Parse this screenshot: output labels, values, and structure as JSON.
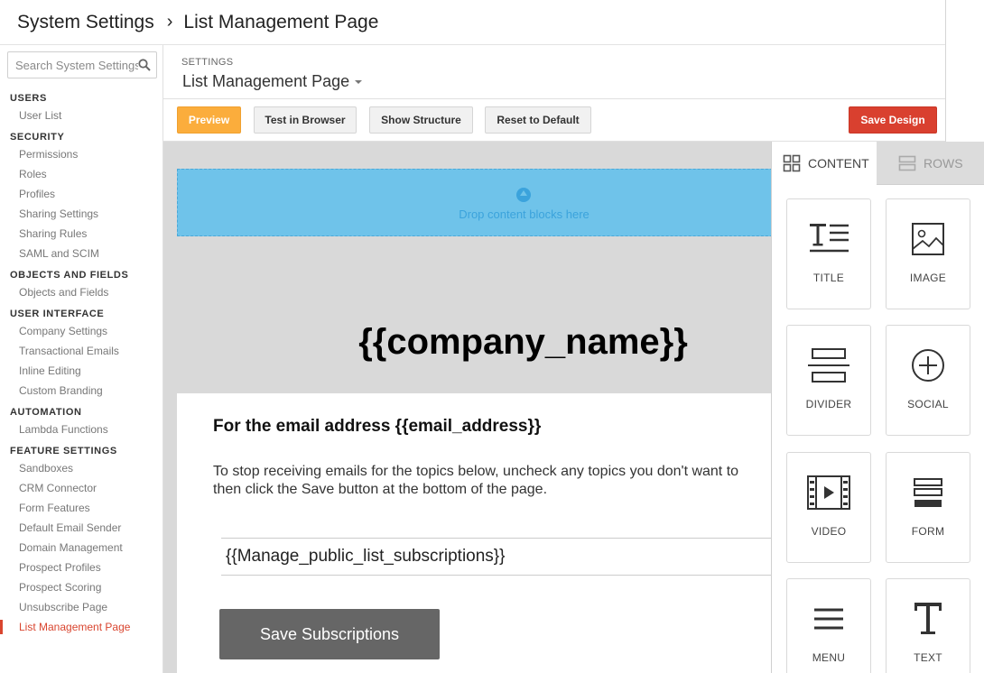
{
  "breadcrumb": {
    "root": "System Settings",
    "separator": "›",
    "current": "List Management Page"
  },
  "search": {
    "placeholder": "Search System Settings"
  },
  "sidebar": {
    "sections": [
      {
        "title": "USERS",
        "items": [
          "User List"
        ]
      },
      {
        "title": "SECURITY",
        "items": [
          "Permissions",
          "Roles",
          "Profiles",
          "Sharing Settings",
          "Sharing Rules",
          "SAML and SCIM"
        ]
      },
      {
        "title": "OBJECTS AND FIELDS",
        "items": [
          "Objects and Fields"
        ]
      },
      {
        "title": "USER INTERFACE",
        "items": [
          "Company Settings",
          "Transactional Emails",
          "Inline Editing",
          "Custom Branding"
        ]
      },
      {
        "title": "AUTOMATION",
        "items": [
          "Lambda Functions"
        ]
      },
      {
        "title": "FEATURE SETTINGS",
        "items": [
          "Sandboxes",
          "CRM Connector",
          "Form Features",
          "Default Email Sender",
          "Domain Management",
          "Prospect Profiles",
          "Prospect Scoring",
          "Unsubscribe Page",
          "List Management Page"
        ]
      }
    ],
    "active": "List Management Page"
  },
  "page_header": {
    "label": "SETTINGS",
    "selected": "List Management Page"
  },
  "toolbar": {
    "preview": "Preview",
    "test": "Test in Browser",
    "structure": "Show Structure",
    "reset": "Reset to Default",
    "save": "Save Design"
  },
  "canvas": {
    "dropzone_text": "Drop content blocks here",
    "company": "{{company_name}}",
    "heading": "For the email address {{email_address}}",
    "body_line1": "To stop receiving emails for the topics below, uncheck any topics you don't want to",
    "body_line2": "then click the Save button at the bottom of the page.",
    "subscriptions": "{{Manage_public_list_subscriptions}}",
    "save_button": "Save Subscriptions"
  },
  "panel": {
    "tabs": {
      "content": "CONTENT",
      "rows": "ROWS"
    },
    "tiles": [
      {
        "label": "TITLE",
        "icon": "title-icon"
      },
      {
        "label": "IMAGE",
        "icon": "image-icon"
      },
      {
        "label": "DIVIDER",
        "icon": "divider-icon"
      },
      {
        "label": "SOCIAL",
        "icon": "social-icon"
      },
      {
        "label": "VIDEO",
        "icon": "video-icon"
      },
      {
        "label": "FORM",
        "icon": "form-icon"
      },
      {
        "label": "MENU",
        "icon": "menu-icon"
      },
      {
        "label": "TEXT",
        "icon": "text-icon"
      }
    ]
  },
  "colors": {
    "preview": "#fbad3c",
    "save": "#d9402f",
    "active_nav": "#d9452f",
    "dropzone": "#6fc3ea"
  }
}
